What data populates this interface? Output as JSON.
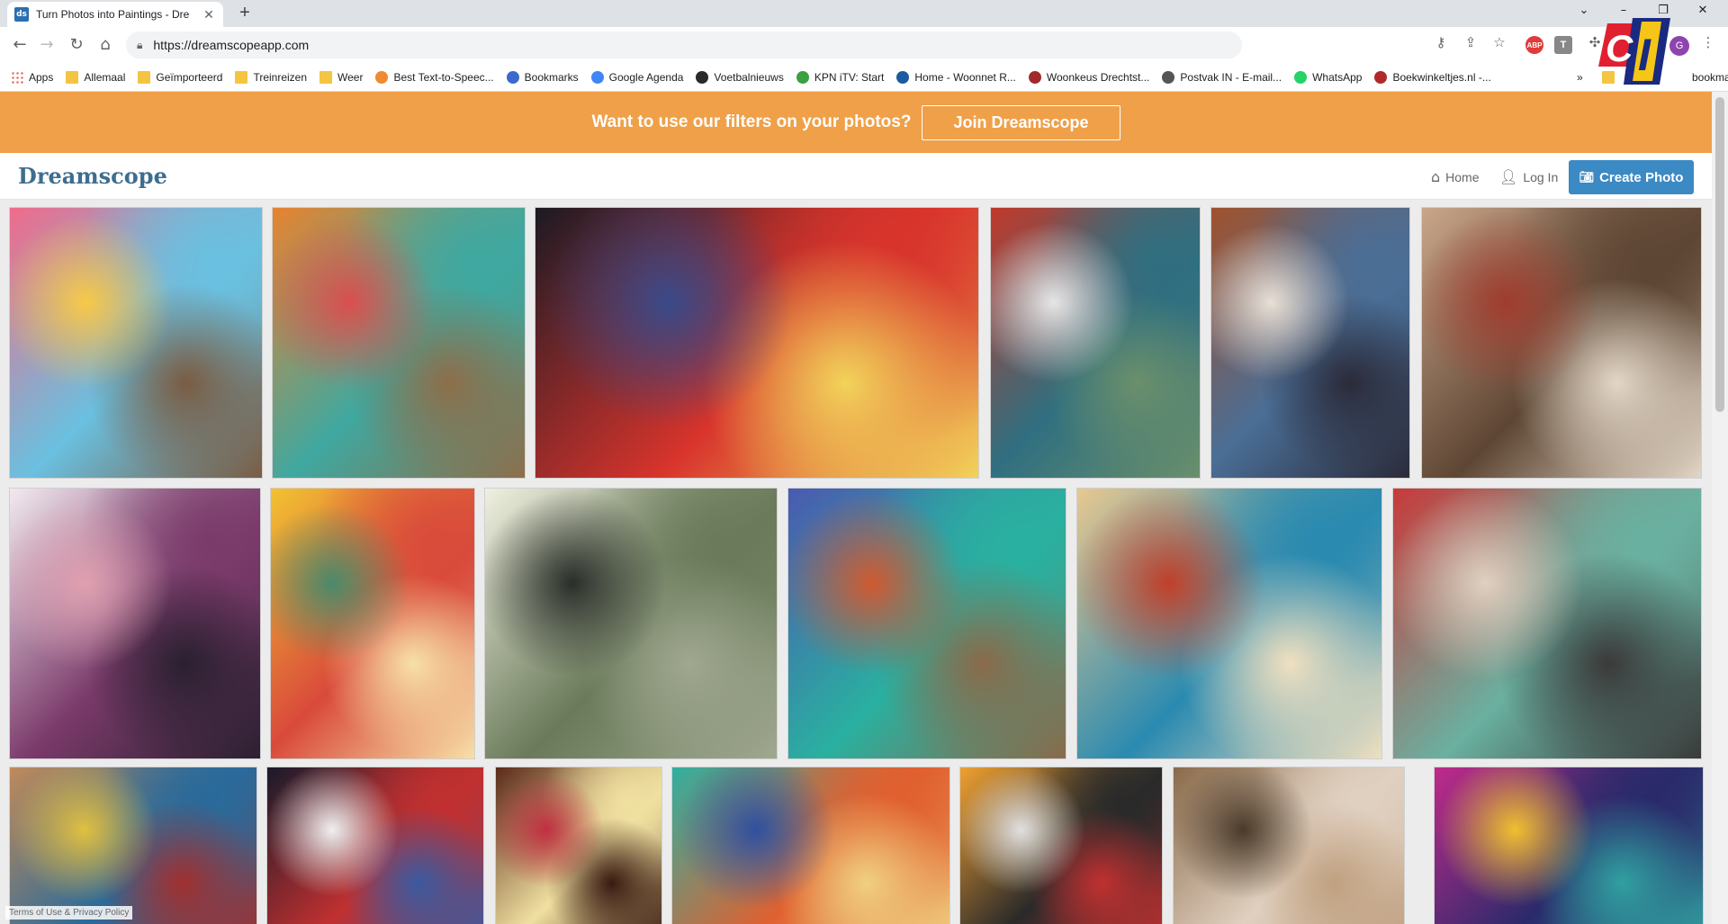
{
  "browser": {
    "tab_title": "Turn Photos into Paintings - Dre",
    "tab_favicon": "ds",
    "url": "https://dreamscopeapp.com",
    "profile_initial": "G",
    "extensions": [
      "ABP",
      "T"
    ],
    "bookmarks": [
      {
        "label": "Apps",
        "icon": "apps-icon"
      },
      {
        "label": "Allemaal",
        "icon": "folder-icon"
      },
      {
        "label": "Geïmporteerd",
        "icon": "folder-icon"
      },
      {
        "label": "Treinreizen",
        "icon": "folder-icon"
      },
      {
        "label": "Weer",
        "icon": "folder-icon"
      },
      {
        "label": "Best Text-to-Speec...",
        "icon": "speech-icon"
      },
      {
        "label": "Bookmarks",
        "icon": "star-icon"
      },
      {
        "label": "Google Agenda",
        "icon": "calendar-icon"
      },
      {
        "label": "Voetbalnieuws",
        "icon": "news-icon"
      },
      {
        "label": "KPN iTV: Start",
        "icon": "kpn-icon"
      },
      {
        "label": "Home - Woonnet R...",
        "icon": "woonnet-icon"
      },
      {
        "label": "Woonkeus Drechtst...",
        "icon": "woonkeus-icon"
      },
      {
        "label": "Postvak IN - E-mail...",
        "icon": "mail-icon"
      },
      {
        "label": "WhatsApp",
        "icon": "whatsapp-icon"
      },
      {
        "label": "Boekwinkeltjes.nl -...",
        "icon": "book-icon"
      }
    ],
    "other_bookmarks": "bookmarks"
  },
  "promo": {
    "text": "Want to use our filters on your photos?",
    "button": "Join Dreamscope"
  },
  "nav": {
    "logo": "Dreamscope",
    "home": "Home",
    "login": "Log In",
    "create": "Create Photo"
  },
  "gallery": {
    "rows": [
      [
        {
          "name": "cat-scarf-colorful-painting",
          "colors": [
            "#f06b8a",
            "#6ac0e0",
            "#f7c948",
            "#7a5c43"
          ]
        },
        {
          "name": "cat-scarf-bright-painting",
          "colors": [
            "#e8832f",
            "#3fa8a0",
            "#d94f4f",
            "#8d6e4a"
          ]
        },
        {
          "name": "black-cat-closeup-painting",
          "colors": [
            "#1c1a24",
            "#d8342c",
            "#3a4a8a",
            "#f2d35a"
          ]
        },
        {
          "name": "woman-white-dress-painting",
          "colors": [
            "#c0392b",
            "#2f6f80",
            "#e6e6e6",
            "#6a8f6b"
          ]
        },
        {
          "name": "winter-trees-painting",
          "colors": [
            "#a0522d",
            "#4a6e96",
            "#e8e0d6",
            "#2b2b3a"
          ]
        },
        {
          "name": "man-portrait-painting",
          "colors": [
            "#c9a68a",
            "#5e4634",
            "#a03c2e",
            "#e2d6c6"
          ]
        }
      ],
      [
        {
          "name": "woman-dark-hair-watercolor",
          "colors": [
            "#f2eaf0",
            "#7a3a6a",
            "#e0a0b0",
            "#2a2030"
          ]
        },
        {
          "name": "girl-lemon-glasses-painting",
          "colors": [
            "#f2c232",
            "#d94a3a",
            "#4a8a6a",
            "#f7e0a8"
          ]
        },
        {
          "name": "moon-village-painting",
          "colors": [
            "#f0f0e0",
            "#6a7a5a",
            "#2a2e2a",
            "#a0a890"
          ]
        },
        {
          "name": "cat-scarf-blue-painting",
          "colors": [
            "#4a5ab0",
            "#2ab0a0",
            "#d05a30",
            "#8a6a4a"
          ]
        },
        {
          "name": "blonde-woman-painting",
          "colors": [
            "#e8c890",
            "#2a8ab0",
            "#c0402a",
            "#f0e0c0"
          ]
        },
        {
          "name": "cat-lying-geometric-painting",
          "colors": [
            "#c83a3a",
            "#6ab0a0",
            "#e0d0c0",
            "#3a3a3a"
          ]
        }
      ],
      [
        {
          "name": "puppy-colorful-painting",
          "colors": [
            "#c08a5a",
            "#2a6a9a",
            "#e0c040",
            "#a03030"
          ]
        },
        {
          "name": "black-cat-mosaic-painting",
          "colors": [
            "#1a1a2a",
            "#c03030",
            "#f0f0f0",
            "#3a5aa0"
          ]
        },
        {
          "name": "flowers-vase-painting",
          "colors": [
            "#5a2a1a",
            "#f0e0a0",
            "#c03040",
            "#3a1a10"
          ]
        },
        {
          "name": "horse-abstract-painting",
          "colors": [
            "#30b0a0",
            "#e06030",
            "#3050a0",
            "#f0d080"
          ]
        },
        {
          "name": "orange-drink-cake-painting",
          "colors": [
            "#f0a030",
            "#2a2a2a",
            "#e0e0e0",
            "#c03030"
          ]
        },
        {
          "name": "white-horse-painting",
          "colors": [
            "#8a6a4a",
            "#e0d0c0",
            "#4a3a2a",
            "#c0a080"
          ]
        },
        {
          "name": "psychedelic-insect-painting",
          "colors": [
            "#c02a8a",
            "#2a2a6a",
            "#f0c030",
            "#30a0a0"
          ]
        }
      ]
    ]
  },
  "footer": {
    "terms": "Terms of Use & Privacy Policy"
  },
  "accent_colors": {
    "promo_bg": "#f0a048",
    "create_button": "#3b8ac4",
    "logo": "#3d6e8f"
  }
}
